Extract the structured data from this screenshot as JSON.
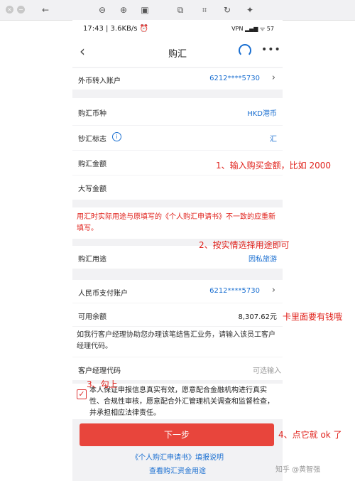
{
  "viewer": {
    "tools": [
      "back-icon",
      "zoom-out-icon",
      "zoom-in-icon",
      "fit-icon",
      "crop-icon",
      "scan-icon",
      "rotate-icon",
      "magic-icon"
    ]
  },
  "status_bar": {
    "time": "17:43 | 3.6KB/s ⏰",
    "right": "VPN ▂▄▆ ᯤ 57"
  },
  "nav": {
    "title": "购汇",
    "back": "‹",
    "more": "•••"
  },
  "rows": {
    "fx_account": {
      "label": "外币转入账户",
      "value": "6212****5730"
    },
    "currency": {
      "label": "购汇币种",
      "value": "HKD港币"
    },
    "cash_flag": {
      "label": "钞汇标志",
      "value": "汇"
    },
    "amount": {
      "label": "购汇金额"
    },
    "amount_upper": {
      "label": "大写金额"
    },
    "purpose": {
      "label": "购汇用途",
      "value": "因私旅游"
    },
    "rmb_account": {
      "label": "人民币支付账户",
      "value": "6212****5730"
    },
    "balance": {
      "label": "可用余额",
      "value": "8,307.62元"
    },
    "manager_code": {
      "label": "客户经理代码",
      "placeholder": "可选输入"
    }
  },
  "notes": {
    "purpose_note": "用汇时实际用途与原填写的《个人购汇申请书》不一致的应重新填写。",
    "manager_note": "如我行客户经理协助您办理该笔结售汇业务，请输入该员工客户经理代码。",
    "declaration": "本人保证申报信息真实有效，愿意配合金融机构进行真实性、合规性审核，愿意配合外汇管理机关调查和监督检查，并承担相应法律责任。"
  },
  "buttons": {
    "next": "下一步"
  },
  "links": {
    "form_help": "《个人购汇申请书》填报说明",
    "funds_usage": "查看购汇资金用途"
  },
  "annotations": {
    "a1": "1、输入购买金额，比如 2000",
    "a2": "2、按实情选择用途即可",
    "a3": "卡里面要有钱哦",
    "a4": "3、勾上",
    "a5": "4、点它就 ok 了"
  },
  "watermark": "知乎 @黄智强",
  "colors": {
    "accent": "#1a6fd1",
    "primary_button": "#e8453c",
    "annotation": "#e0211b"
  }
}
